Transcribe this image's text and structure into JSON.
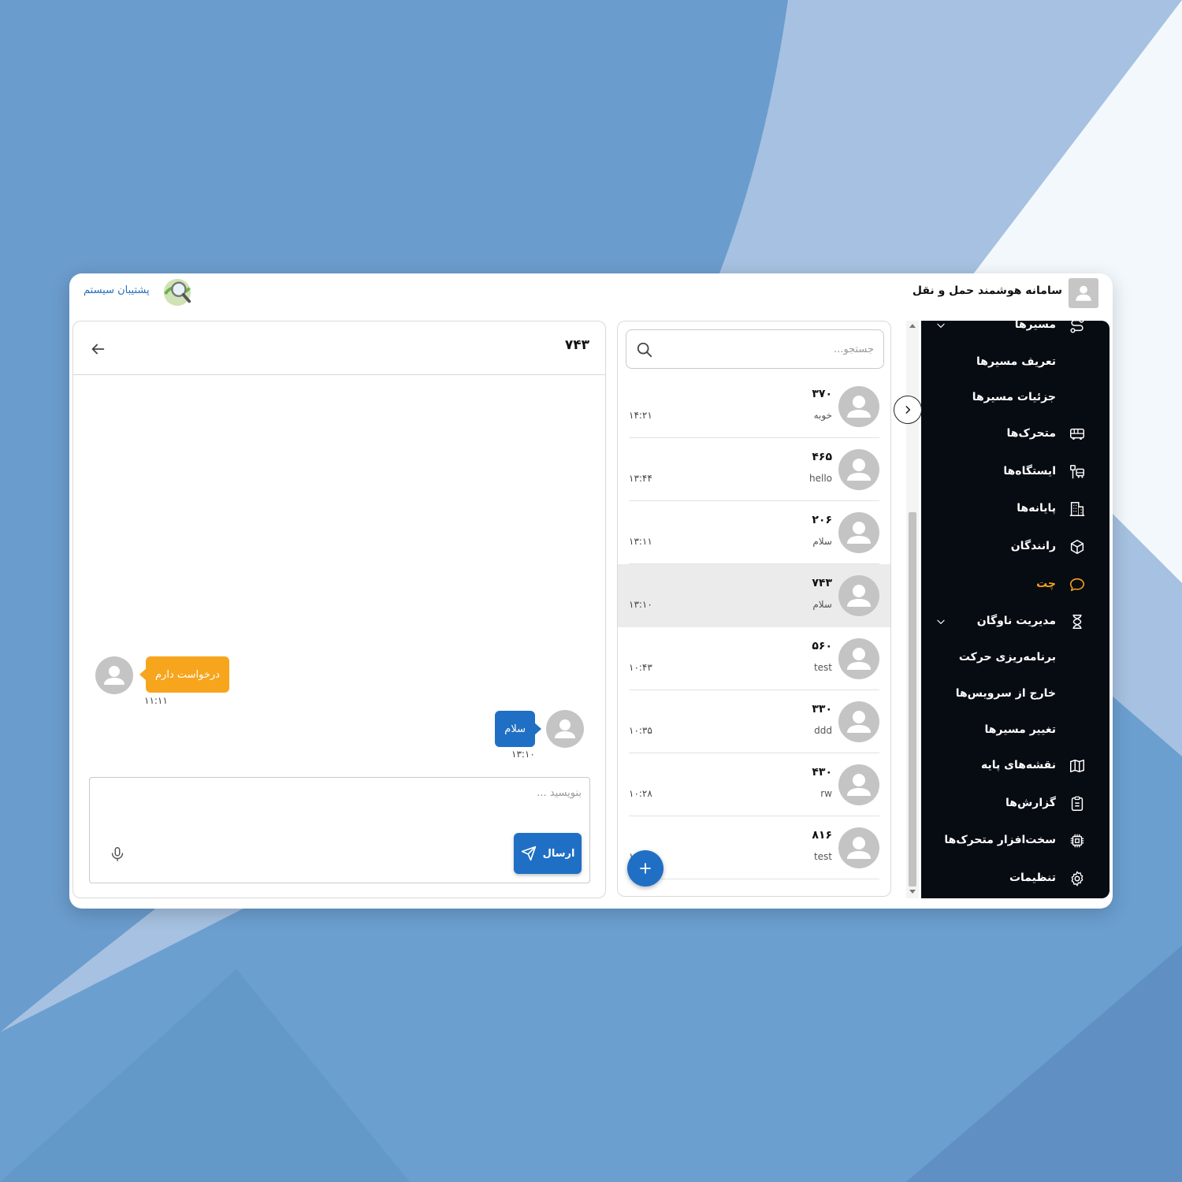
{
  "app": {
    "title": "سامانه هوشمند حمل و نقل",
    "support_link": "پشتیبان سیستم"
  },
  "sidebar": {
    "items": [
      {
        "label": "مسیرها",
        "icon": "route-icon",
        "expandable": true
      },
      {
        "label": "تعریف مسیرها",
        "icon": null
      },
      {
        "label": "جزئیات مسیرها",
        "icon": null
      },
      {
        "label": "متحرک‌ها",
        "icon": "bus-icon"
      },
      {
        "label": "ایستگاه‌ها",
        "icon": "bus-stop-icon"
      },
      {
        "label": "پایانه‌ها",
        "icon": "building-icon"
      },
      {
        "label": "رانندگان",
        "icon": "steering-wheel-icon"
      },
      {
        "label": "چت",
        "icon": "chat-bubble-icon",
        "active": true
      },
      {
        "label": "مدیریت ناوگان",
        "icon": "hourglass-icon",
        "expandable": true
      },
      {
        "label": "برنامه‌ریزی حرکت",
        "icon": null
      },
      {
        "label": "خارج از سرویس‌ها",
        "icon": null
      },
      {
        "label": "تغییر مسیرها",
        "icon": null
      },
      {
        "label": "نقشه‌های پایه",
        "icon": "map-icon"
      },
      {
        "label": "گزارش‌ها",
        "icon": "clipboard-icon"
      },
      {
        "label": "سخت‌افزار متحرک‌ها",
        "icon": "chip-icon"
      },
      {
        "label": "تنظیمات",
        "icon": "gear-icon"
      }
    ],
    "active_color": "#f6a21b"
  },
  "chatlist": {
    "search_placeholder": "جستجو...",
    "conversations": [
      {
        "name": "۳۷۰",
        "preview": "خوبه",
        "time": "۱۴:۲۱"
      },
      {
        "name": "۴۶۵",
        "preview": "hello",
        "time": "۱۳:۴۴"
      },
      {
        "name": "۲۰۶",
        "preview": "سلام",
        "time": "۱۳:۱۱"
      },
      {
        "name": "۷۴۳",
        "preview": "سلام",
        "time": "۱۳:۱۰",
        "selected": true
      },
      {
        "name": "۵۶۰",
        "preview": "test",
        "time": "۱۰:۴۳"
      },
      {
        "name": "۳۳۰",
        "preview": "ddd",
        "time": "۱۰:۳۵"
      },
      {
        "name": "۴۳۰",
        "preview": "rw",
        "time": "۱۰:۲۸"
      },
      {
        "name": "۸۱۶",
        "preview": "test",
        "time": "۱"
      }
    ],
    "fab_icon": "plus-icon"
  },
  "chat": {
    "title": "۷۴۳",
    "messages": [
      {
        "text": "درخواست دارم",
        "time": "۱۱:۱۱",
        "direction": "incoming"
      },
      {
        "text": "سلام",
        "time": "۱۳:۱۰",
        "direction": "outgoing"
      }
    ],
    "composer_placeholder": "بنویسید ...",
    "send_label": "ارسال"
  },
  "colors": {
    "primary": "#1f6fc5",
    "incoming_bubble": "#f7a51c",
    "sidebar_bg": "#070b12"
  }
}
